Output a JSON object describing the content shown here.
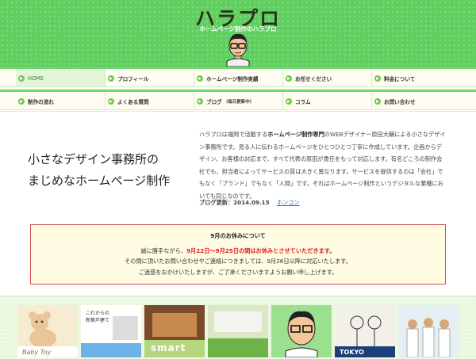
{
  "header": {
    "logo": "ハラプロ",
    "tagline": "ホームページ制作のハラプロ",
    "colors": {
      "green": "#5fcf5f",
      "accent_red": "#e02020",
      "link": "#2a6ac7"
    }
  },
  "nav": {
    "row1": [
      "HOME",
      "プロフィール",
      "ホームページ制作実績",
      "お任せください",
      "料金について"
    ],
    "row2": [
      {
        "label": "制作の流れ",
        "note": ""
      },
      {
        "label": "よくある質問",
        "note": ""
      },
      {
        "label": "ブログ",
        "note": "（毎日更新中）"
      },
      {
        "label": "コラム",
        "note": ""
      },
      {
        "label": "お問い合わせ",
        "note": ""
      }
    ]
  },
  "intro": {
    "hero_line1": "小さなデザイン事務所の",
    "hero_line2": "まじめなホームページ制作",
    "desc_part1": "ハラプロは福岡で活動する",
    "desc_bold": "ホームページ制作専門",
    "desc_part2": "のWEBデザイナー原田大輔による小さなデザイン事務所です。見る人に伝わるホームページをひとつひとつ丁寧に作成しています。企画からデザイン、お客様の対応まで、すべて代表の原田が責任をもって対応します。有名どころの制作会社でも、担当者によってサービスの質は大きく異なります。サービスを提供するのは「会社」でもなく「ブランド」でもなく「人間」です。それはホームページ制作というデジタルな業種においても同じなのです。",
    "blog_label": "ブログ更新：",
    "blog_date": "2014.09.15",
    "blog_link": "ホンコン"
  },
  "notice": {
    "title": "9月のお休みについて",
    "line1_pre": "誠に勝手ながら、",
    "line1_hl": "9月22日～9月25日の間はお休みとさせていただきます。",
    "line2": "その間に頂いたお問い合わせやご連絡につきましては、9月26日以降に対応いたします。",
    "line3": "ご迷惑をおかけいたしますが、ご了承くださいますようお願い申し上げます。"
  },
  "gallery": {
    "captions": [
      "これからの新築戸建て",
      "smart",
      "TOKYO"
    ]
  }
}
